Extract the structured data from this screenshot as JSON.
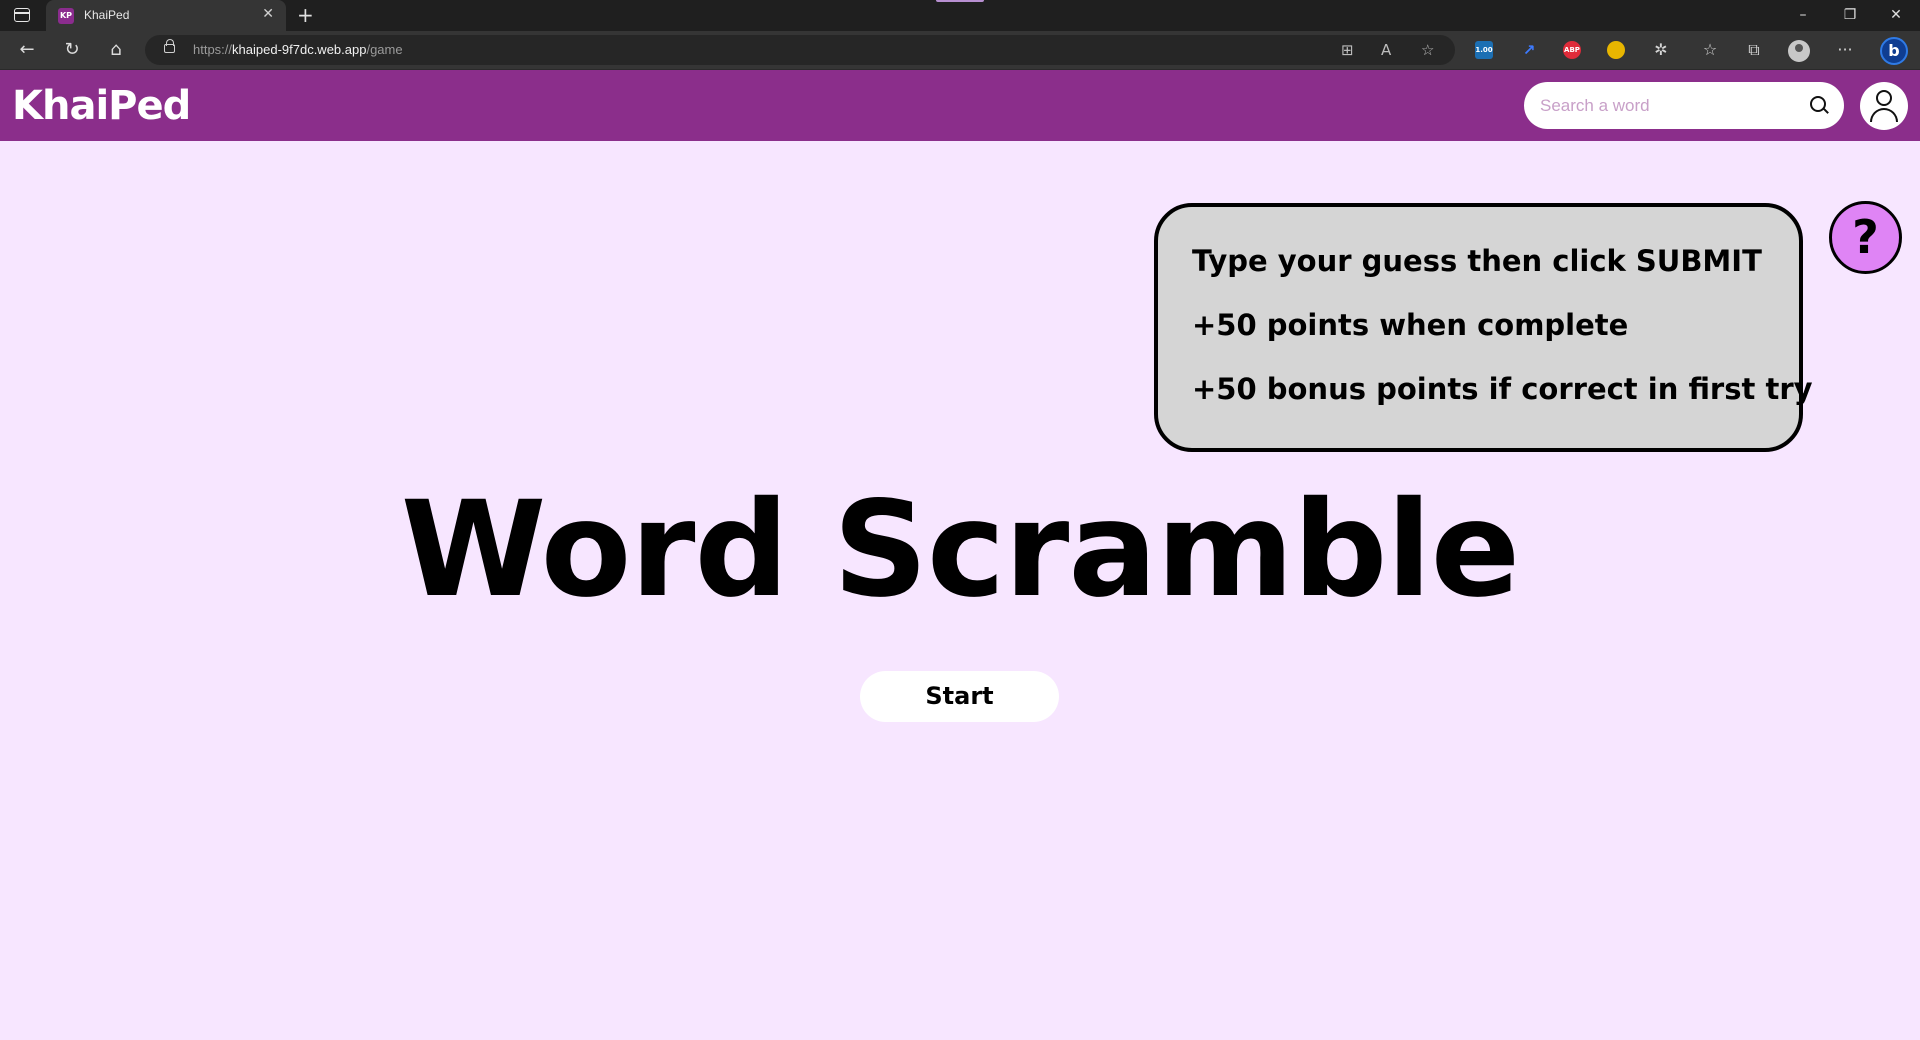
{
  "browser": {
    "tab": {
      "favicon_text": "KP",
      "title": "KhaiPed"
    },
    "url": {
      "prefix": "https://",
      "host": "khaiped-9f7dc.web.app",
      "path": "/game"
    },
    "extensions": {
      "badge": "1.00",
      "adblock": "ABP"
    }
  },
  "header": {
    "logo": "KhaiPed",
    "search_placeholder": "Search a word"
  },
  "help": {
    "button_label": "?",
    "lines": [
      "Type your guess then click SUBMIT",
      "+50 points when complete",
      "+50 bonus points if correct in first try"
    ]
  },
  "game": {
    "title": "Word Scramble",
    "start_label": "Start"
  },
  "colors": {
    "header_bg": "#8b2e8b",
    "page_bg": "#f7e6ff",
    "help_button": "#df84f5",
    "help_panel": "#d5d5d5"
  }
}
